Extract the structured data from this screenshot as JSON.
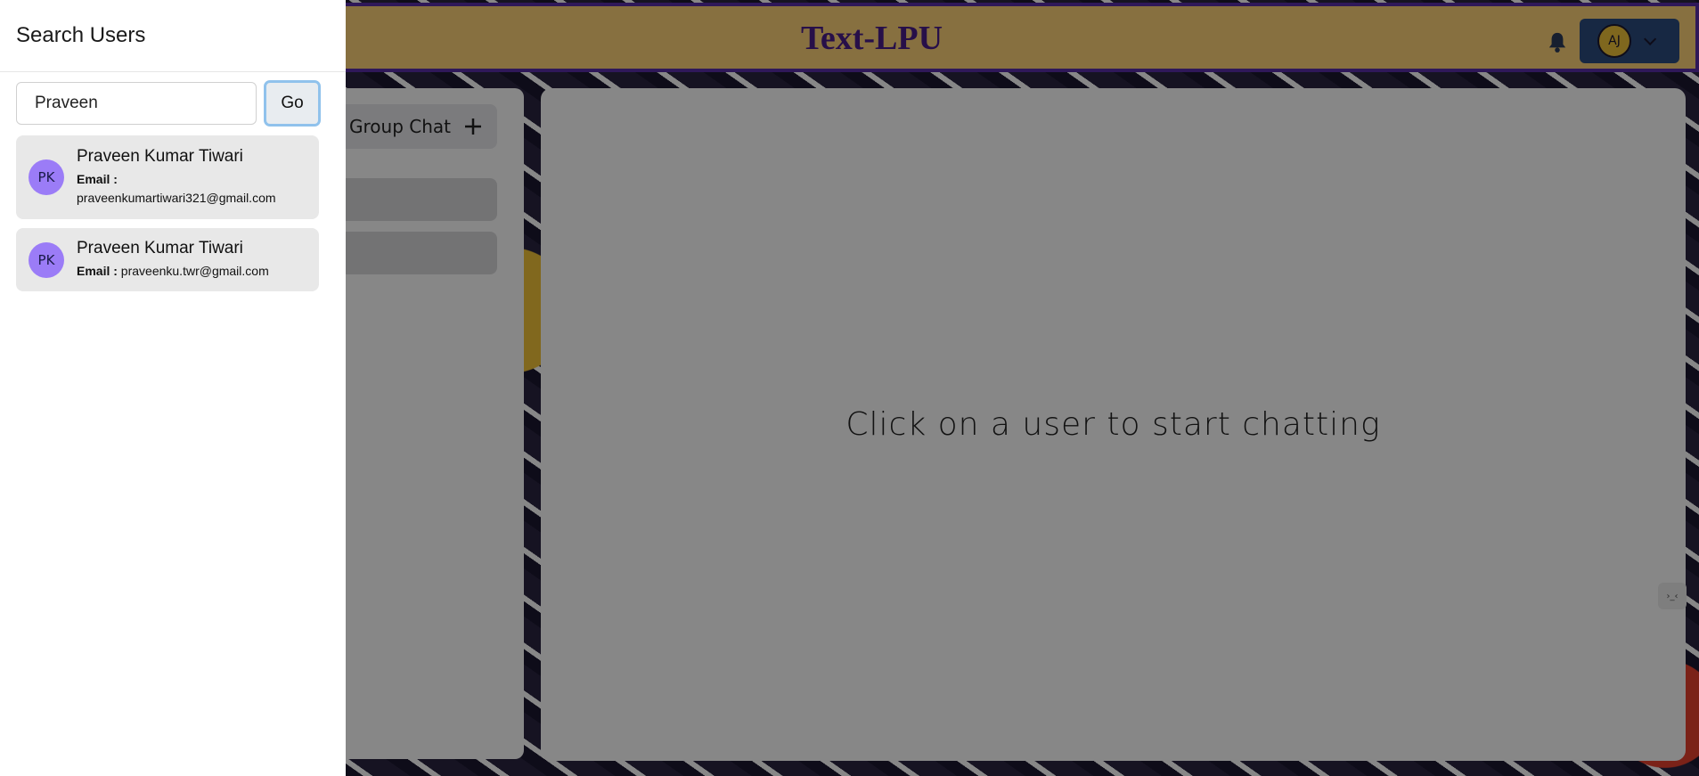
{
  "header": {
    "title": "Text-LPU",
    "profile_initials": "AJ"
  },
  "sidebar": {
    "group_chat_label": "Group Chat"
  },
  "chat": {
    "empty_message": "Click on a user to start chatting"
  },
  "drawer": {
    "title": "Search Users",
    "search_value": "Praveen",
    "go_label": "Go",
    "email_label": "Email :",
    "results": [
      {
        "initials": "PK",
        "name": "Praveen Kumar Tiwari",
        "email": "praveenkumartiwari321@gmail.com"
      },
      {
        "initials": "PK",
        "name": "Praveen Kumar Tiwari",
        "email": "praveenku.twr@gmail.com"
      }
    ]
  },
  "dev_badge": "›_‹",
  "colors": {
    "header_bg": "#ffd37a",
    "header_border": "#5a2fa8",
    "title": "#4b1e8a",
    "avatar_bg": "#9b7cf7",
    "go_border": "#90c2ec"
  }
}
